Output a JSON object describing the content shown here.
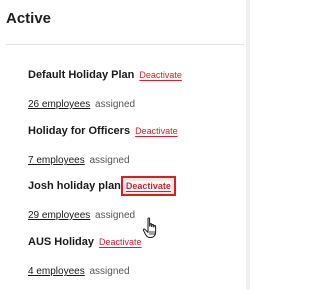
{
  "section": {
    "heading": "Active"
  },
  "plans": [
    {
      "name": "Default Holiday Plan",
      "action": "Deactivate",
      "employees": "26 employees",
      "assigned": "assigned"
    },
    {
      "name": "Holiday for Officers",
      "action": "Deactivate",
      "employees": "7 employees",
      "assigned": "assigned"
    },
    {
      "name": "Josh holiday plan",
      "action": "Deactivate",
      "employees": "29 employees",
      "assigned": "assigned"
    },
    {
      "name": "AUS Holiday",
      "action": "Deactivate",
      "employees": "4 employees",
      "assigned": "assigned"
    }
  ],
  "colors": {
    "deactivate": "#d0212d",
    "highlight": "#d62020"
  },
  "icons": {
    "cursor": "hand-pointer-icon"
  }
}
